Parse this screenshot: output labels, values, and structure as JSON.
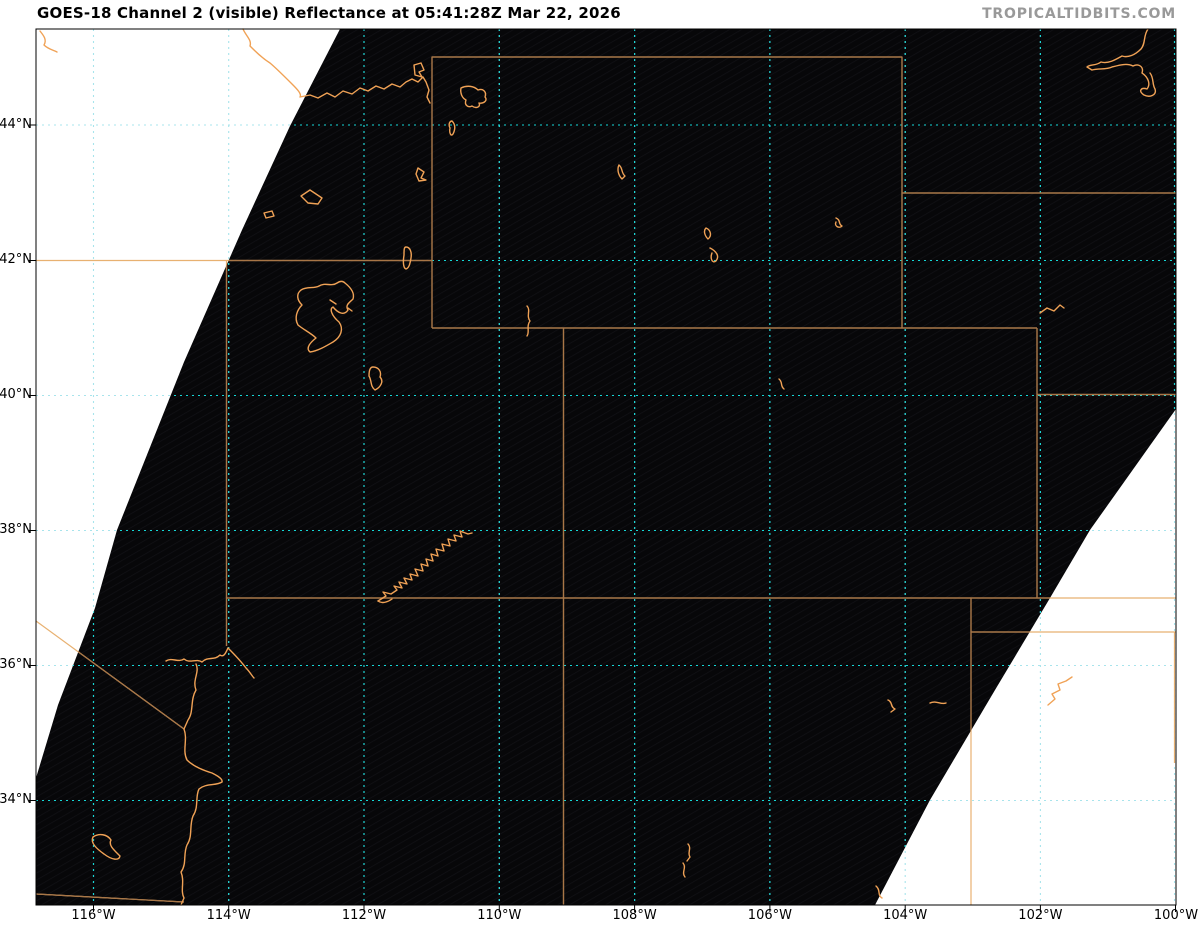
{
  "title": "GOES-18 Channel 2 (visible) Reflectance at 05:41:28Z Mar 22, 2026",
  "watermark": "TROPICALTIDBITS.COM",
  "map_info": {
    "satellite": "GOES-18",
    "channel": "Channel 2 (visible)",
    "product": "Reflectance",
    "time": "05:41:28Z",
    "date": "Mar 22, 2026"
  },
  "axes": {
    "lat": [
      "44°N",
      "42°N",
      "40°N",
      "38°N",
      "36°N",
      "34°N"
    ],
    "lon": [
      "116°W",
      "114°W",
      "112°W",
      "110°W",
      "108°W",
      "106°W",
      "104°W",
      "102°W",
      "100°W"
    ]
  },
  "colors": {
    "night_imagery_background": "#070709",
    "no_data_wedge": "#ffffff",
    "grid_on_dark": "#15d6d6",
    "grid_on_light": "#a8e4ec",
    "state_border_on_dark": "#a87647",
    "state_border_on_light": "#e8b171",
    "water_feature": "#f0a256",
    "axis_spine": "#000000",
    "title_text": "#000000",
    "watermark_text": "#999999"
  },
  "overlays": [
    "latitude-longitude-grid",
    "state-borders",
    "rivers-lakes-coastlines",
    "off-scan-no-data-wedges"
  ]
}
